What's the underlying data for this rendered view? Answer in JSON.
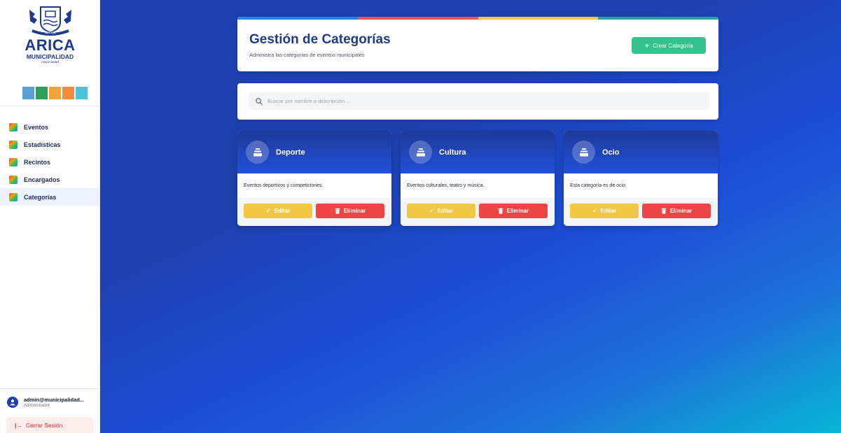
{
  "brand": {
    "name": "ARICA",
    "subtitle": "MUNICIPALIDAD",
    "tagline": "mejorciudad",
    "crest_text": "ARICA",
    "stripe_colors": [
      "#5aa0d8",
      "#2f9e5b",
      "#f2a33a",
      "#f28b3a",
      "#4cc3d9"
    ]
  },
  "sidebar": {
    "items": [
      {
        "label": "Eventos",
        "active": false
      },
      {
        "label": "Estadísticas",
        "active": false
      },
      {
        "label": "Recintos",
        "active": false
      },
      {
        "label": "Encargados",
        "active": false
      },
      {
        "label": "Categorías",
        "active": true
      }
    ],
    "user": {
      "email": "admin@municipalidad...",
      "role": "Administrador"
    },
    "logout_label": "Cerrar Sesión"
  },
  "header": {
    "title": "Gestión de Categorías",
    "subtitle": "Administra las categorías de eventos municipales",
    "create_label": "Crear Categoría",
    "bar_colors": [
      "#1e88e5",
      "#ef5350",
      "#f2c744",
      "#26a69a"
    ]
  },
  "search": {
    "placeholder": "Buscar por nombre o descripción..."
  },
  "categories": [
    {
      "name": "Deporte",
      "description": "Eventos deportivos y competiciones."
    },
    {
      "name": "Cultura",
      "description": "Eventos culturales, teatro y música."
    },
    {
      "name": "Ocio",
      "description": "Esta categoría es de ocio"
    }
  ],
  "card_actions": {
    "edit_label": "Editar",
    "delete_label": "Eliminar"
  },
  "colors": {
    "primary": "#1e3a8a",
    "success": "#34c38f",
    "warning": "#f2c744",
    "danger": "#ef4444"
  }
}
